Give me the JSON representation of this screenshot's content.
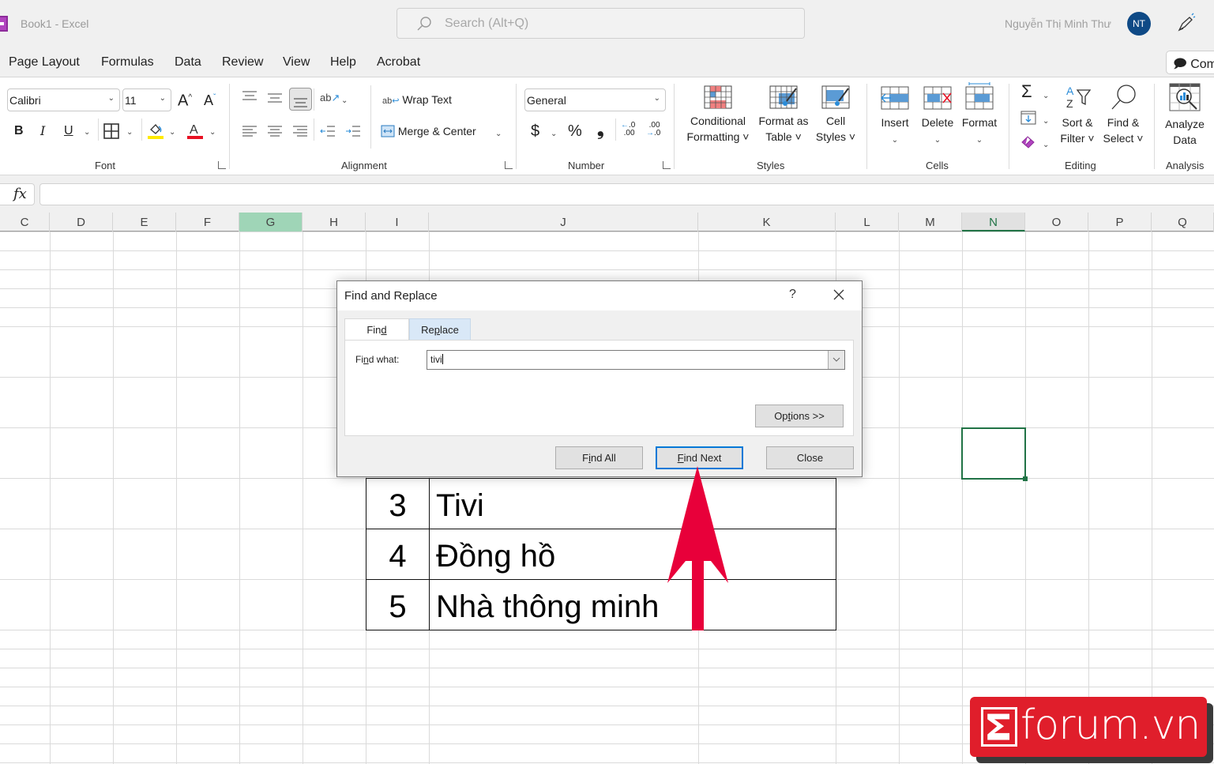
{
  "titlebar": {
    "title": "Book1  -  Excel",
    "search_placeholder": "Search (Alt+Q)",
    "user_name": "Nguyễn Thị Minh Thư",
    "avatar_initials": "NT"
  },
  "menu_tabs": [
    "Page Layout",
    "Formulas",
    "Data",
    "Review",
    "View",
    "Help",
    "Acrobat"
  ],
  "comments_label": "Com",
  "ribbon": {
    "font": {
      "name": "Calibri",
      "size": "11",
      "label": "Font",
      "bold": "B",
      "italic": "I",
      "underline": "U"
    },
    "alignment": {
      "wrap_text": "Wrap Text",
      "merge_center": "Merge & Center",
      "label": "Alignment"
    },
    "number": {
      "format": "General",
      "currency": "$",
      "percent": "%",
      "comma": "❟",
      "label": "Number"
    },
    "styles": {
      "conditional": [
        "Conditional",
        "Formatting ˅"
      ],
      "format_table": [
        "Format as",
        "Table ˅"
      ],
      "cell_styles": [
        "Cell",
        "Styles ˅"
      ],
      "label": "Styles"
    },
    "cells": {
      "insert": "Insert",
      "delete": "Delete",
      "format": "Format",
      "label": "Cells"
    },
    "editing": {
      "sort": [
        "Sort &",
        "Filter ˅"
      ],
      "find": [
        "Find &",
        "Select ˅"
      ],
      "label": "Editing"
    },
    "analysis": {
      "analyze": [
        "Analyze",
        "Data"
      ],
      "label": "Analysis"
    }
  },
  "formula_bar": {
    "fx": "fx",
    "value": ""
  },
  "columns": [
    "C",
    "D",
    "E",
    "F",
    "G",
    "H",
    "I",
    "J",
    "K",
    "L",
    "M",
    "N",
    "O",
    "P",
    "Q"
  ],
  "table_rows": [
    {
      "no": "3",
      "name": "Tivi"
    },
    {
      "no": "4",
      "name": "Đồng hồ"
    },
    {
      "no": "5",
      "name": "Nhà thông minh"
    }
  ],
  "dialog": {
    "title": "Find and Replace",
    "help": "?",
    "tabs": {
      "find": [
        "Fin",
        "d",
        ""
      ],
      "replace": [
        "Re",
        "p",
        "lace"
      ]
    },
    "find_what_label": [
      "Fi",
      "n",
      "d what:"
    ],
    "find_what_value": "tivi",
    "options": [
      "Op",
      "t",
      "ions >>"
    ],
    "find_all": [
      "F",
      "i",
      "nd All"
    ],
    "find_next": [
      "",
      "F",
      "ind Next"
    ],
    "close": "Close"
  },
  "watermark": "forum.vn",
  "colors": {
    "accent": "#217346",
    "arrow": "#e8003a",
    "watermark": "#e01e2b"
  }
}
